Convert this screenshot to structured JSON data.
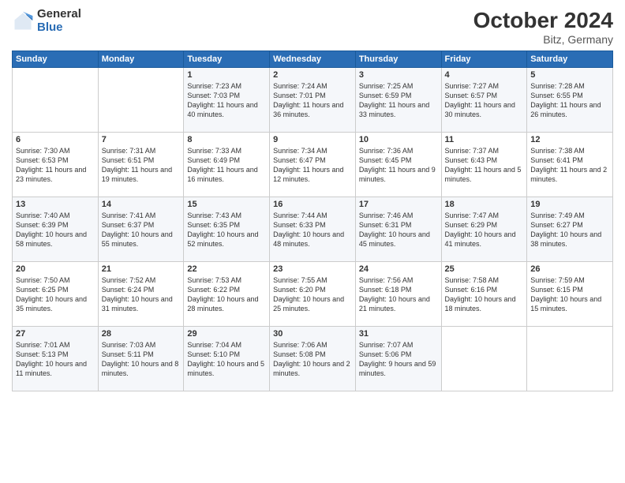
{
  "header": {
    "logo_general": "General",
    "logo_blue": "Blue",
    "title": "October 2024",
    "location": "Bitz, Germany"
  },
  "days_of_week": [
    "Sunday",
    "Monday",
    "Tuesday",
    "Wednesday",
    "Thursday",
    "Friday",
    "Saturday"
  ],
  "weeks": [
    [
      {
        "day": "",
        "content": ""
      },
      {
        "day": "",
        "content": ""
      },
      {
        "day": "1",
        "content": "Sunrise: 7:23 AM\nSunset: 7:03 PM\nDaylight: 11 hours and 40 minutes."
      },
      {
        "day": "2",
        "content": "Sunrise: 7:24 AM\nSunset: 7:01 PM\nDaylight: 11 hours and 36 minutes."
      },
      {
        "day": "3",
        "content": "Sunrise: 7:25 AM\nSunset: 6:59 PM\nDaylight: 11 hours and 33 minutes."
      },
      {
        "day": "4",
        "content": "Sunrise: 7:27 AM\nSunset: 6:57 PM\nDaylight: 11 hours and 30 minutes."
      },
      {
        "day": "5",
        "content": "Sunrise: 7:28 AM\nSunset: 6:55 PM\nDaylight: 11 hours and 26 minutes."
      }
    ],
    [
      {
        "day": "6",
        "content": "Sunrise: 7:30 AM\nSunset: 6:53 PM\nDaylight: 11 hours and 23 minutes."
      },
      {
        "day": "7",
        "content": "Sunrise: 7:31 AM\nSunset: 6:51 PM\nDaylight: 11 hours and 19 minutes."
      },
      {
        "day": "8",
        "content": "Sunrise: 7:33 AM\nSunset: 6:49 PM\nDaylight: 11 hours and 16 minutes."
      },
      {
        "day": "9",
        "content": "Sunrise: 7:34 AM\nSunset: 6:47 PM\nDaylight: 11 hours and 12 minutes."
      },
      {
        "day": "10",
        "content": "Sunrise: 7:36 AM\nSunset: 6:45 PM\nDaylight: 11 hours and 9 minutes."
      },
      {
        "day": "11",
        "content": "Sunrise: 7:37 AM\nSunset: 6:43 PM\nDaylight: 11 hours and 5 minutes."
      },
      {
        "day": "12",
        "content": "Sunrise: 7:38 AM\nSunset: 6:41 PM\nDaylight: 11 hours and 2 minutes."
      }
    ],
    [
      {
        "day": "13",
        "content": "Sunrise: 7:40 AM\nSunset: 6:39 PM\nDaylight: 10 hours and 58 minutes."
      },
      {
        "day": "14",
        "content": "Sunrise: 7:41 AM\nSunset: 6:37 PM\nDaylight: 10 hours and 55 minutes."
      },
      {
        "day": "15",
        "content": "Sunrise: 7:43 AM\nSunset: 6:35 PM\nDaylight: 10 hours and 52 minutes."
      },
      {
        "day": "16",
        "content": "Sunrise: 7:44 AM\nSunset: 6:33 PM\nDaylight: 10 hours and 48 minutes."
      },
      {
        "day": "17",
        "content": "Sunrise: 7:46 AM\nSunset: 6:31 PM\nDaylight: 10 hours and 45 minutes."
      },
      {
        "day": "18",
        "content": "Sunrise: 7:47 AM\nSunset: 6:29 PM\nDaylight: 10 hours and 41 minutes."
      },
      {
        "day": "19",
        "content": "Sunrise: 7:49 AM\nSunset: 6:27 PM\nDaylight: 10 hours and 38 minutes."
      }
    ],
    [
      {
        "day": "20",
        "content": "Sunrise: 7:50 AM\nSunset: 6:25 PM\nDaylight: 10 hours and 35 minutes."
      },
      {
        "day": "21",
        "content": "Sunrise: 7:52 AM\nSunset: 6:24 PM\nDaylight: 10 hours and 31 minutes."
      },
      {
        "day": "22",
        "content": "Sunrise: 7:53 AM\nSunset: 6:22 PM\nDaylight: 10 hours and 28 minutes."
      },
      {
        "day": "23",
        "content": "Sunrise: 7:55 AM\nSunset: 6:20 PM\nDaylight: 10 hours and 25 minutes."
      },
      {
        "day": "24",
        "content": "Sunrise: 7:56 AM\nSunset: 6:18 PM\nDaylight: 10 hours and 21 minutes."
      },
      {
        "day": "25",
        "content": "Sunrise: 7:58 AM\nSunset: 6:16 PM\nDaylight: 10 hours and 18 minutes."
      },
      {
        "day": "26",
        "content": "Sunrise: 7:59 AM\nSunset: 6:15 PM\nDaylight: 10 hours and 15 minutes."
      }
    ],
    [
      {
        "day": "27",
        "content": "Sunrise: 7:01 AM\nSunset: 5:13 PM\nDaylight: 10 hours and 11 minutes."
      },
      {
        "day": "28",
        "content": "Sunrise: 7:03 AM\nSunset: 5:11 PM\nDaylight: 10 hours and 8 minutes."
      },
      {
        "day": "29",
        "content": "Sunrise: 7:04 AM\nSunset: 5:10 PM\nDaylight: 10 hours and 5 minutes."
      },
      {
        "day": "30",
        "content": "Sunrise: 7:06 AM\nSunset: 5:08 PM\nDaylight: 10 hours and 2 minutes."
      },
      {
        "day": "31",
        "content": "Sunrise: 7:07 AM\nSunset: 5:06 PM\nDaylight: 9 hours and 59 minutes."
      },
      {
        "day": "",
        "content": ""
      },
      {
        "day": "",
        "content": ""
      }
    ]
  ]
}
